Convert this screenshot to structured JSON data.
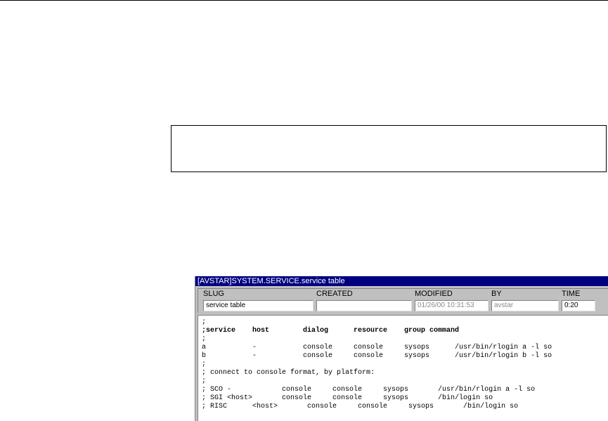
{
  "window": {
    "title": "[AVSTAR]SYSTEM.SERVICE.service table"
  },
  "header": {
    "slug_label": "SLUG",
    "slug_value": "service table",
    "created_label": "CREATED",
    "created_value": "",
    "modified_label": "MODIFIED",
    "modified_value": "01/26/00 10:31:53",
    "by_label": "BY",
    "by_value": "avstar",
    "time_label": "TIME",
    "time_value": "0:20"
  },
  "content": {
    "lines": [
      ";",
      ";service    host        dialog      resource    group command",
      ";",
      "a           -           console     console     sysops      /usr/bin/rlogin a -l so",
      "b           -           console     console     sysops      /usr/bin/rlogin b -l so",
      ";",
      "; connect to console format, by platform:",
      ";",
      "; SCO -            console     console     sysops       /usr/bin/rlogin a -l so",
      "; SGI <host>       console     console     sysops       /bin/login so",
      "; RISC      <host>       console     console     sysops       /bin/login so"
    ]
  }
}
